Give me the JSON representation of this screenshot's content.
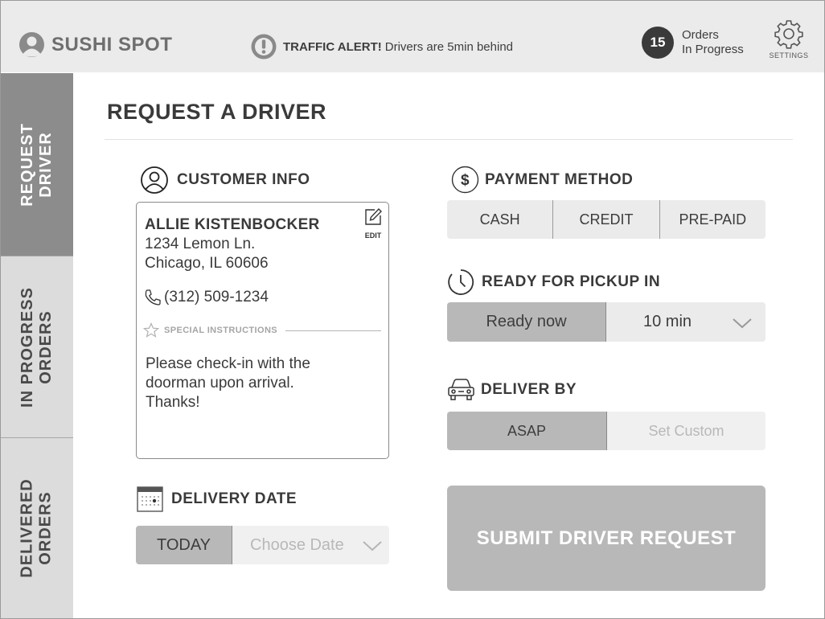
{
  "header": {
    "brand_name": "SUSHI SPOT",
    "alert_bold": "TRAFFIC ALERT!",
    "alert_text": "Drivers are 5min behind",
    "orders_count": "15",
    "orders_label_line1": "Orders",
    "orders_label_line2": "In Progress",
    "settings_label": "SETTINGS"
  },
  "sidebar": {
    "items": [
      {
        "line1": "REQUEST",
        "line2": "DRIVER",
        "active": true
      },
      {
        "line1": "IN PROGRESS",
        "line2": "ORDERS",
        "active": false
      },
      {
        "line1": "DELIVERED",
        "line2": "ORDERS",
        "active": false
      }
    ]
  },
  "main": {
    "page_title": "REQUEST A DRIVER",
    "customer_info": {
      "heading": "CUSTOMER INFO",
      "name": "ALLIE KISTENBOCKER",
      "address_line1": "1234 Lemon Ln.",
      "address_line2": "Chicago, IL 60606",
      "phone": "(312) 509-1234",
      "edit_label": "EDIT",
      "special_label": "SPECIAL INSTRUCTIONS",
      "instructions": "Please check-in with the doorman upon arrival. Thanks!"
    },
    "delivery_date": {
      "heading": "DELIVERY DATE",
      "selected": "TODAY",
      "placeholder": "Choose Date"
    },
    "payment_method": {
      "heading": "PAYMENT METHOD",
      "options": [
        "CASH",
        "CREDIT",
        "PRE-PAID"
      ]
    },
    "pickup": {
      "heading": "READY FOR PICKUP IN",
      "selected": "Ready now",
      "dropdown_value": "10 min"
    },
    "deliver_by": {
      "heading": "DELIVER BY",
      "selected": "ASAP",
      "alternate": "Set Custom"
    },
    "submit_label": "SUBMIT DRIVER REQUEST"
  },
  "colors": {
    "header_bg": "#ebebeb",
    "sidebar_active": "#8c8c8c",
    "sidebar_inactive": "#dcdcdc",
    "selected_segment": "#b8b8b8",
    "badge": "#3a3a3a"
  }
}
